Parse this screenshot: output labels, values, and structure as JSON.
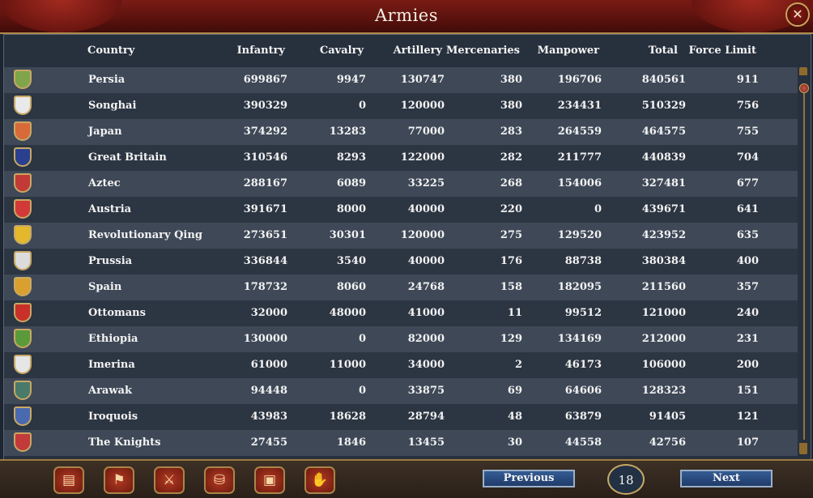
{
  "window": {
    "title": "Armies",
    "close_label": "✕"
  },
  "table": {
    "headers": {
      "country": "Country",
      "infantry": "Infantry",
      "cavalry": "Cavalry",
      "artillery": "Artillery",
      "mercenaries": "Mercenaries",
      "manpower": "Manpower",
      "total": "Total",
      "force_limit": "Force Limit"
    },
    "rows": [
      {
        "country": "Persia",
        "infantry": "699867",
        "cavalry": "9947",
        "artillery": "130747",
        "mercenaries": "380",
        "manpower": "196706",
        "total": "840561",
        "force_limit": "911",
        "flag": "#7fa44a"
      },
      {
        "country": "Songhai",
        "infantry": "390329",
        "cavalry": "0",
        "artillery": "120000",
        "mercenaries": "380",
        "manpower": "234431",
        "total": "510329",
        "force_limit": "756",
        "flag": "#e9e9e9"
      },
      {
        "country": "Japan",
        "infantry": "374292",
        "cavalry": "13283",
        "artillery": "77000",
        "mercenaries": "283",
        "manpower": "264559",
        "total": "464575",
        "force_limit": "755",
        "flag": "#d86a3a"
      },
      {
        "country": "Great Britain",
        "infantry": "310546",
        "cavalry": "8293",
        "artillery": "122000",
        "mercenaries": "282",
        "manpower": "211777",
        "total": "440839",
        "force_limit": "704",
        "flag": "#2b3f8f"
      },
      {
        "country": "Aztec",
        "infantry": "288167",
        "cavalry": "6089",
        "artillery": "33225",
        "mercenaries": "268",
        "manpower": "154006",
        "total": "327481",
        "force_limit": "677",
        "flag": "#c23a36"
      },
      {
        "country": "Austria",
        "infantry": "391671",
        "cavalry": "8000",
        "artillery": "40000",
        "mercenaries": "220",
        "manpower": "0",
        "total": "439671",
        "force_limit": "641",
        "flag": "#d23a3a"
      },
      {
        "country": "Revolutionary Qing",
        "infantry": "273651",
        "cavalry": "30301",
        "artillery": "120000",
        "mercenaries": "275",
        "manpower": "129520",
        "total": "423952",
        "force_limit": "635",
        "flag": "#e4b82d"
      },
      {
        "country": "Prussia",
        "infantry": "336844",
        "cavalry": "3540",
        "artillery": "40000",
        "mercenaries": "176",
        "manpower": "88738",
        "total": "380384",
        "force_limit": "400",
        "flag": "#dcdcdc"
      },
      {
        "country": "Spain",
        "infantry": "178732",
        "cavalry": "8060",
        "artillery": "24768",
        "mercenaries": "158",
        "manpower": "182095",
        "total": "211560",
        "force_limit": "357",
        "flag": "#d9a030"
      },
      {
        "country": "Ottomans",
        "infantry": "32000",
        "cavalry": "48000",
        "artillery": "41000",
        "mercenaries": "11",
        "manpower": "99512",
        "total": "121000",
        "force_limit": "240",
        "flag": "#c9302a"
      },
      {
        "country": "Ethiopia",
        "infantry": "130000",
        "cavalry": "0",
        "artillery": "82000",
        "mercenaries": "129",
        "manpower": "134169",
        "total": "212000",
        "force_limit": "231",
        "flag": "#5b9a3a"
      },
      {
        "country": "Imerina",
        "infantry": "61000",
        "cavalry": "11000",
        "artillery": "34000",
        "mercenaries": "2",
        "manpower": "46173",
        "total": "106000",
        "force_limit": "200",
        "flag": "#e6e6e6"
      },
      {
        "country": "Arawak",
        "infantry": "94448",
        "cavalry": "0",
        "artillery": "33875",
        "mercenaries": "69",
        "manpower": "64606",
        "total": "128323",
        "force_limit": "151",
        "flag": "#4a7a6a"
      },
      {
        "country": "Iroquois",
        "infantry": "43983",
        "cavalry": "18628",
        "artillery": "28794",
        "mercenaries": "48",
        "manpower": "63879",
        "total": "91405",
        "force_limit": "121",
        "flag": "#4a6ab0"
      },
      {
        "country": "The Knights",
        "infantry": "27455",
        "cavalry": "1846",
        "artillery": "13455",
        "mercenaries": "30",
        "manpower": "44558",
        "total": "42756",
        "force_limit": "107",
        "flag": "#c23a3a"
      }
    ]
  },
  "bottom": {
    "buttons": [
      {
        "name": "ledger-button",
        "icon": "scroll-icon",
        "glyph": "▤"
      },
      {
        "name": "flags-button",
        "icon": "flag-icon",
        "glyph": "⚑"
      },
      {
        "name": "armies-button",
        "icon": "crossed-swords-icon",
        "glyph": "⚔"
      },
      {
        "name": "economy-button",
        "icon": "coins-icon",
        "glyph": "⛁"
      },
      {
        "name": "trade-button",
        "icon": "crate-icon",
        "glyph": "▣"
      },
      {
        "name": "diplomacy-button",
        "icon": "handshake-icon",
        "glyph": "✋"
      }
    ],
    "previous_label": "Previous",
    "next_label": "Next",
    "page": "18"
  }
}
